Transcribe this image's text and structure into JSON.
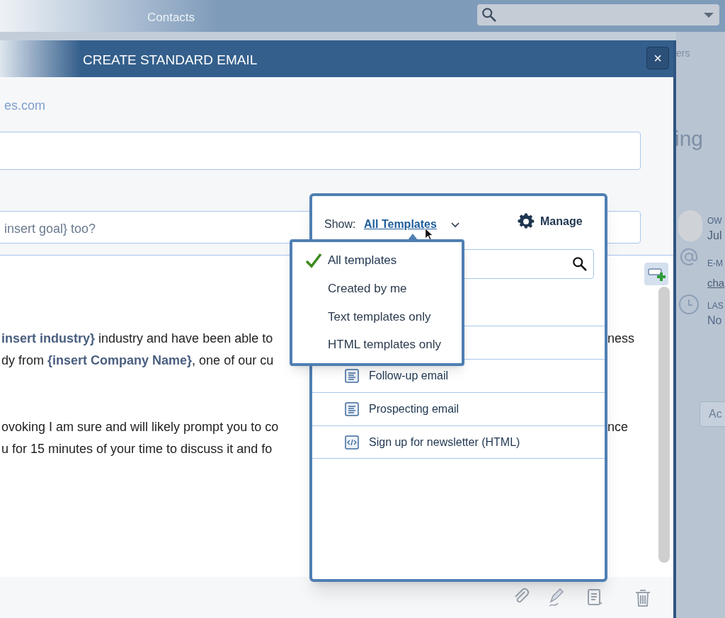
{
  "app_bar": {
    "title": "Contacts"
  },
  "background": {
    "tab_label": "ers",
    "heading": "ing",
    "owner_label": "OW",
    "owner_name": "Jul",
    "email_label": "E-M",
    "email_value": "cha",
    "last_label": "LAS",
    "last_value": "No",
    "button": "Ac"
  },
  "dialog": {
    "title": "CREATE STANDARD EMAIL",
    "close": "×",
    "from": "es.com",
    "subject": "insert goal} too?",
    "body": [
      {
        "left": "**insert industry}** industry and have been able to",
        "right": "ness"
      },
      {
        "left": "dy from **{insert Company Name}**, one of our cu"
      },
      {
        "left": "ovoking I am sure and will likely prompt you to co",
        "right": "nce"
      },
      {
        "left": "u for 15 minutes of your time to discuss it and fo"
      }
    ]
  },
  "template_picker": {
    "show_label": "Show:",
    "filter": "All Templates",
    "manage": "Manage",
    "filters": [
      {
        "label": "All templates",
        "selected": true
      },
      {
        "label": "Created by me",
        "selected": false
      },
      {
        "label": "Text templates only",
        "selected": false
      },
      {
        "label": "HTML templates only",
        "selected": false
      }
    ],
    "templates": [
      {
        "kind": "text",
        "name": "Follow-up email"
      },
      {
        "kind": "text",
        "name": "Prospecting email"
      },
      {
        "kind": "html",
        "name": "Sign up for newsletter (HTML)"
      }
    ]
  }
}
